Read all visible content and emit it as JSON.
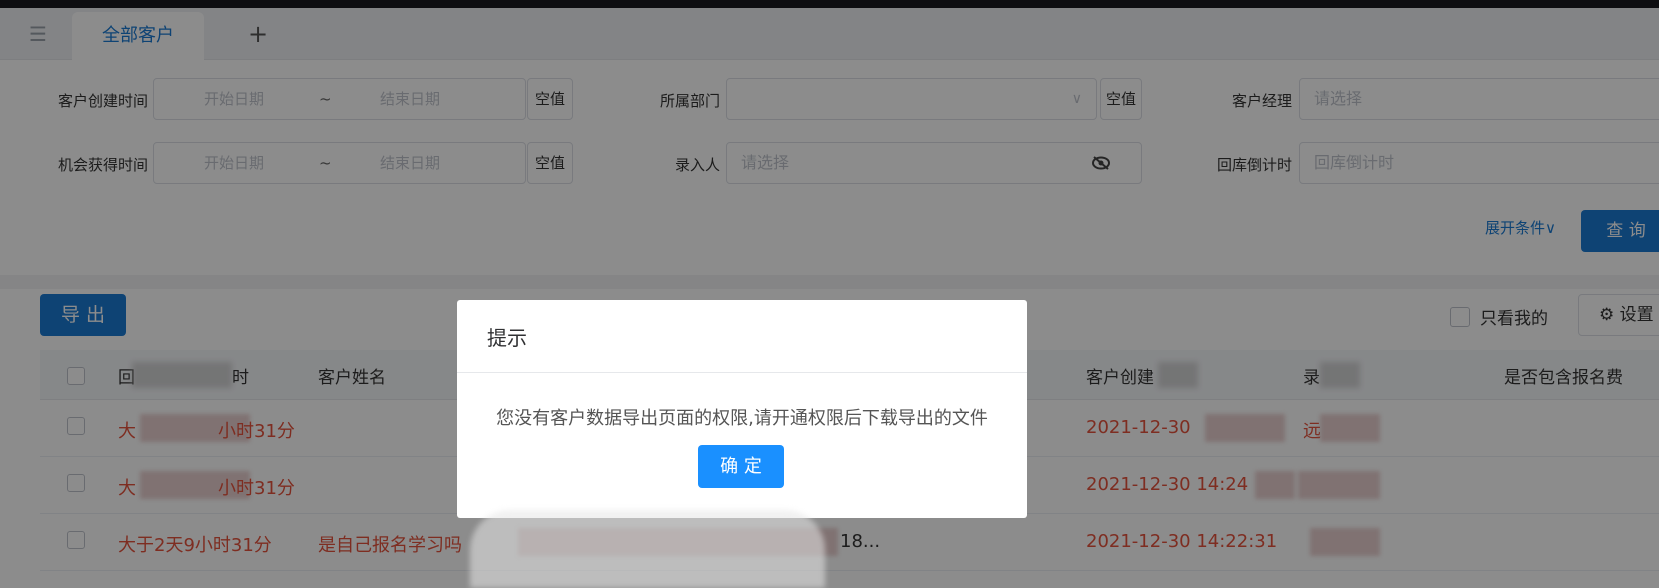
{
  "tabs": {
    "items": [
      {
        "label": "全部客户"
      }
    ],
    "add_label": "+"
  },
  "filters": {
    "create_time": {
      "label": "客户创建时间",
      "start_placeholder": "开始日期",
      "separator": "~",
      "end_placeholder": "结束日期",
      "null_label": "空值"
    },
    "opportunity_time": {
      "label": "机会获得时间",
      "start_placeholder": "开始日期",
      "separator": "~",
      "end_placeholder": "结束日期",
      "null_label": "空值"
    },
    "department": {
      "label": "所属部门",
      "value": "",
      "null_label": "空值"
    },
    "recorder": {
      "label": "录入人",
      "placeholder": "请选择"
    },
    "manager": {
      "label": "客户经理",
      "placeholder": "请选择"
    },
    "countdown": {
      "label": "回库倒计时",
      "placeholder": "回库倒计时"
    },
    "expand_label": "展开条件∨",
    "query_label": "查 询"
  },
  "toolbar": {
    "export_label": "导 出",
    "only_mine_label": "只看我的",
    "settings_label": "设置"
  },
  "table": {
    "headers": [
      "回",
      "时",
      "客户姓名",
      "客户创建",
      "录",
      "是否包含报名费"
    ],
    "rows": [
      {
        "countdown_a": "大",
        "countdown_b": "小时31分",
        "name": "",
        "extra": "",
        "created": "2021-12-30",
        "owner": "远"
      },
      {
        "countdown_a": "大",
        "countdown_b": "小时31分",
        "name": "",
        "extra": "",
        "created": "2021-12-30 14:24",
        "owner": ""
      },
      {
        "countdown_a": "大于2天9小时31分",
        "countdown_b": "",
        "name": "是自己报名学习吗",
        "extra": "18...",
        "created": "2021-12-30 14:22:31",
        "owner": ""
      }
    ]
  },
  "dialog": {
    "title": "提示",
    "message": "您没有客户数据导出页面的权限,请开通权限后下载导出的文件",
    "ok_label": "确 定"
  },
  "colors": {
    "primary": "#1a7ad4",
    "dialog_button": "#1a90ff",
    "warning_text": "#e5533d"
  }
}
